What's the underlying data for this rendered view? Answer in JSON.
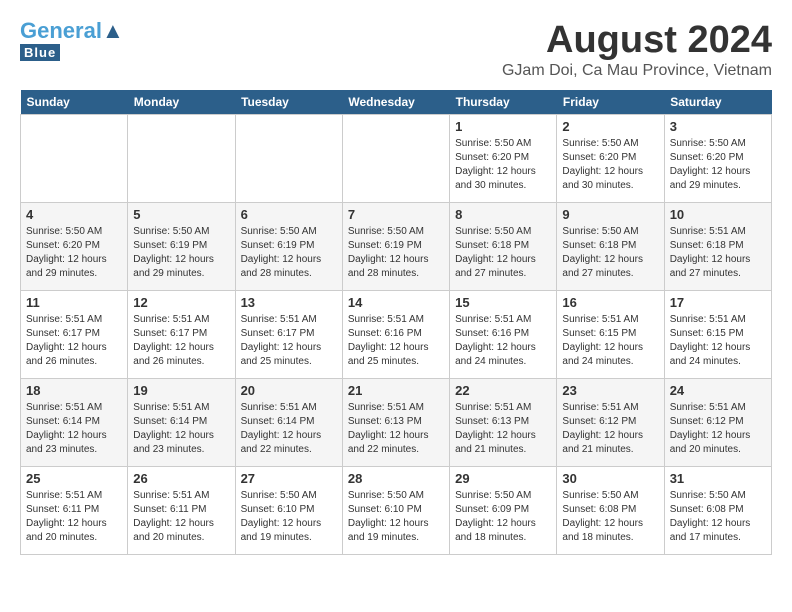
{
  "header": {
    "logo_general": "General",
    "logo_blue": "Blue",
    "month_year": "August 2024",
    "location": "GJam Doi, Ca Mau Province, Vietnam"
  },
  "weekdays": [
    "Sunday",
    "Monday",
    "Tuesday",
    "Wednesday",
    "Thursday",
    "Friday",
    "Saturday"
  ],
  "weeks": [
    [
      {
        "day": "",
        "info": ""
      },
      {
        "day": "",
        "info": ""
      },
      {
        "day": "",
        "info": ""
      },
      {
        "day": "",
        "info": ""
      },
      {
        "day": "1",
        "info": "Sunrise: 5:50 AM\nSunset: 6:20 PM\nDaylight: 12 hours\nand 30 minutes."
      },
      {
        "day": "2",
        "info": "Sunrise: 5:50 AM\nSunset: 6:20 PM\nDaylight: 12 hours\nand 30 minutes."
      },
      {
        "day": "3",
        "info": "Sunrise: 5:50 AM\nSunset: 6:20 PM\nDaylight: 12 hours\nand 29 minutes."
      }
    ],
    [
      {
        "day": "4",
        "info": "Sunrise: 5:50 AM\nSunset: 6:20 PM\nDaylight: 12 hours\nand 29 minutes."
      },
      {
        "day": "5",
        "info": "Sunrise: 5:50 AM\nSunset: 6:19 PM\nDaylight: 12 hours\nand 29 minutes."
      },
      {
        "day": "6",
        "info": "Sunrise: 5:50 AM\nSunset: 6:19 PM\nDaylight: 12 hours\nand 28 minutes."
      },
      {
        "day": "7",
        "info": "Sunrise: 5:50 AM\nSunset: 6:19 PM\nDaylight: 12 hours\nand 28 minutes."
      },
      {
        "day": "8",
        "info": "Sunrise: 5:50 AM\nSunset: 6:18 PM\nDaylight: 12 hours\nand 27 minutes."
      },
      {
        "day": "9",
        "info": "Sunrise: 5:50 AM\nSunset: 6:18 PM\nDaylight: 12 hours\nand 27 minutes."
      },
      {
        "day": "10",
        "info": "Sunrise: 5:51 AM\nSunset: 6:18 PM\nDaylight: 12 hours\nand 27 minutes."
      }
    ],
    [
      {
        "day": "11",
        "info": "Sunrise: 5:51 AM\nSunset: 6:17 PM\nDaylight: 12 hours\nand 26 minutes."
      },
      {
        "day": "12",
        "info": "Sunrise: 5:51 AM\nSunset: 6:17 PM\nDaylight: 12 hours\nand 26 minutes."
      },
      {
        "day": "13",
        "info": "Sunrise: 5:51 AM\nSunset: 6:17 PM\nDaylight: 12 hours\nand 25 minutes."
      },
      {
        "day": "14",
        "info": "Sunrise: 5:51 AM\nSunset: 6:16 PM\nDaylight: 12 hours\nand 25 minutes."
      },
      {
        "day": "15",
        "info": "Sunrise: 5:51 AM\nSunset: 6:16 PM\nDaylight: 12 hours\nand 24 minutes."
      },
      {
        "day": "16",
        "info": "Sunrise: 5:51 AM\nSunset: 6:15 PM\nDaylight: 12 hours\nand 24 minutes."
      },
      {
        "day": "17",
        "info": "Sunrise: 5:51 AM\nSunset: 6:15 PM\nDaylight: 12 hours\nand 24 minutes."
      }
    ],
    [
      {
        "day": "18",
        "info": "Sunrise: 5:51 AM\nSunset: 6:14 PM\nDaylight: 12 hours\nand 23 minutes."
      },
      {
        "day": "19",
        "info": "Sunrise: 5:51 AM\nSunset: 6:14 PM\nDaylight: 12 hours\nand 23 minutes."
      },
      {
        "day": "20",
        "info": "Sunrise: 5:51 AM\nSunset: 6:14 PM\nDaylight: 12 hours\nand 22 minutes."
      },
      {
        "day": "21",
        "info": "Sunrise: 5:51 AM\nSunset: 6:13 PM\nDaylight: 12 hours\nand 22 minutes."
      },
      {
        "day": "22",
        "info": "Sunrise: 5:51 AM\nSunset: 6:13 PM\nDaylight: 12 hours\nand 21 minutes."
      },
      {
        "day": "23",
        "info": "Sunrise: 5:51 AM\nSunset: 6:12 PM\nDaylight: 12 hours\nand 21 minutes."
      },
      {
        "day": "24",
        "info": "Sunrise: 5:51 AM\nSunset: 6:12 PM\nDaylight: 12 hours\nand 20 minutes."
      }
    ],
    [
      {
        "day": "25",
        "info": "Sunrise: 5:51 AM\nSunset: 6:11 PM\nDaylight: 12 hours\nand 20 minutes."
      },
      {
        "day": "26",
        "info": "Sunrise: 5:51 AM\nSunset: 6:11 PM\nDaylight: 12 hours\nand 20 minutes."
      },
      {
        "day": "27",
        "info": "Sunrise: 5:50 AM\nSunset: 6:10 PM\nDaylight: 12 hours\nand 19 minutes."
      },
      {
        "day": "28",
        "info": "Sunrise: 5:50 AM\nSunset: 6:10 PM\nDaylight: 12 hours\nand 19 minutes."
      },
      {
        "day": "29",
        "info": "Sunrise: 5:50 AM\nSunset: 6:09 PM\nDaylight: 12 hours\nand 18 minutes."
      },
      {
        "day": "30",
        "info": "Sunrise: 5:50 AM\nSunset: 6:08 PM\nDaylight: 12 hours\nand 18 minutes."
      },
      {
        "day": "31",
        "info": "Sunrise: 5:50 AM\nSunset: 6:08 PM\nDaylight: 12 hours\nand 17 minutes."
      }
    ]
  ]
}
